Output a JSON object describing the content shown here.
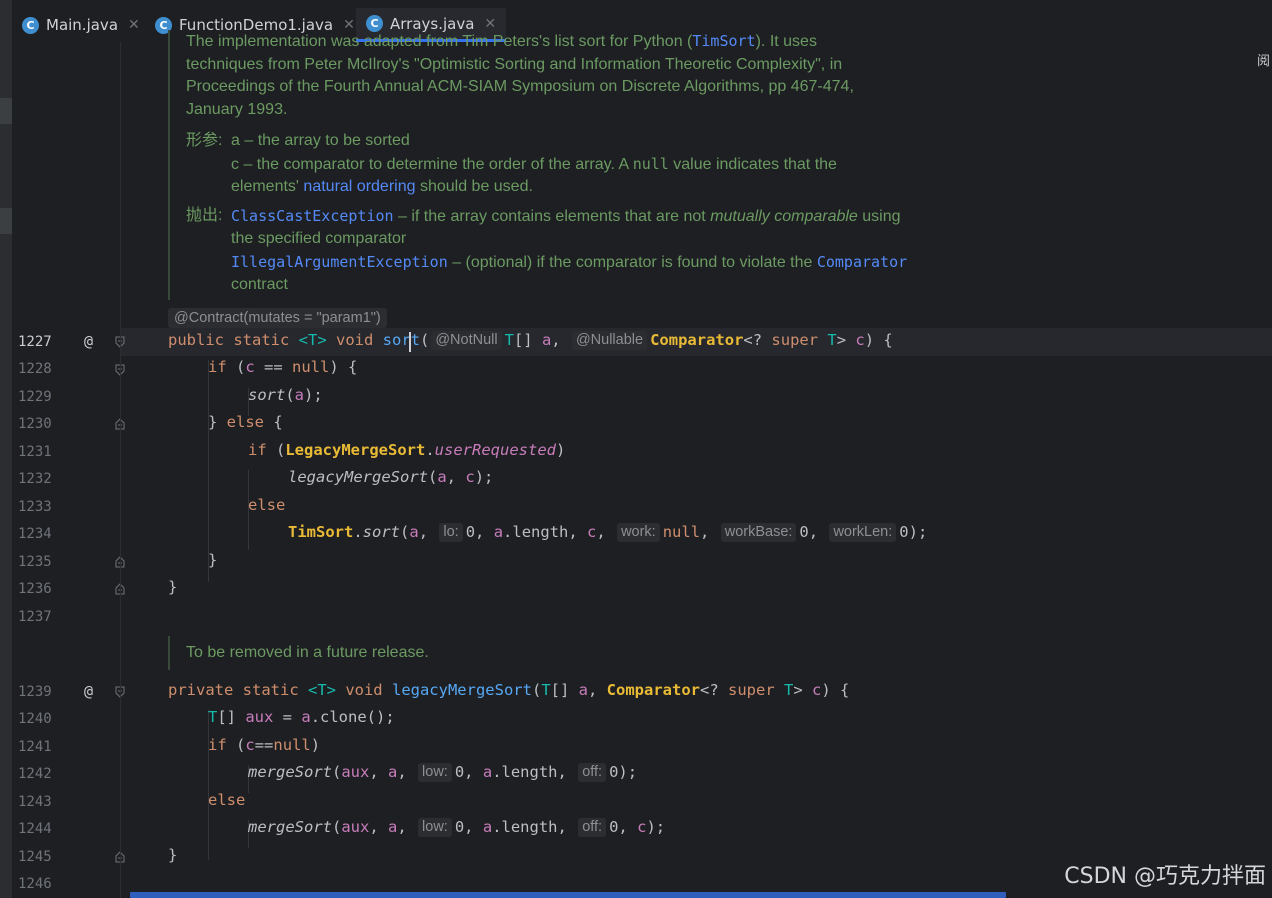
{
  "tabs": [
    {
      "label": "Main.java",
      "icon": "C"
    },
    {
      "label": "FunctionDemo1.java",
      "icon": "C"
    },
    {
      "label": "Arrays.java",
      "icon": "C"
    }
  ],
  "side_label": "阅",
  "doc1": {
    "partial_top": "The implementation was adapted from Tim Peters's list sort for Python (",
    "partial_top_link": "TimSort",
    "partial_top_end": "). It uses",
    "line2": "techniques from Peter McIlroy's \"Optimistic Sorting and Information Theoretic Complexity\", in",
    "line3": "Proceedings of the Fourth Annual ACM-SIAM Symposium on Discrete Algorithms, pp 467-474,",
    "line4": "January 1993.",
    "params_label": "形参:",
    "param_a": "a – the array to be sorted",
    "param_c_1": "c – the comparator to determine the order of the array. A ",
    "param_c_null": "null",
    "param_c_2": " value indicates that the",
    "param_c_3": "elements' ",
    "param_c_link": "natural ordering",
    "param_c_4": " should be used.",
    "throws_label": "抛出:",
    "throws1_cls": "ClassCastException",
    "throws1_text": " – if the array contains elements that are not ",
    "throws1_em": "mutually comparable",
    "throws1_end": " using",
    "throws1_cont": "the specified comparator",
    "throws2_cls": "IllegalArgumentException",
    "throws2_text": " – (optional) if the comparator is found to violate the ",
    "throws2_link": "Comparator",
    "throws2_cont": "contract"
  },
  "contract_hint": "@Contract(mutates = \"param1\")",
  "doc2": "To be removed in a future release.",
  "line_numbers": [
    "1227",
    "1228",
    "1229",
    "1230",
    "1231",
    "1232",
    "1233",
    "1234",
    "1235",
    "1236",
    "1237",
    "1239",
    "1240",
    "1241",
    "1242",
    "1243",
    "1244",
    "1245",
    "1246"
  ],
  "code": {
    "l1227": {
      "kw1": "public static ",
      "tp": "<T> ",
      "kw2": "void ",
      "fn": "sort",
      "p1": "(",
      "h1": "@NotNull",
      "tp2": "T",
      "p2": "[] ",
      "a": "a",
      "p3": ", ",
      "h2": "@Nullable",
      "cls": "Comparator",
      "p4": "<? ",
      "kw3": "super ",
      "tp3": "T",
      "p5": "> ",
      "c": "c",
      "p6": ") {"
    },
    "l1228": {
      "kw": "if ",
      "p1": "(",
      "c": "c",
      "p2": " == ",
      "nl": "null",
      "p3": ") {"
    },
    "l1229": {
      "fn": "sort",
      "p1": "(",
      "a": "a",
      "p2": ");"
    },
    "l1230": {
      "p1": "} ",
      "kw": "else",
      "p2": " {"
    },
    "l1231": {
      "kw": "if ",
      "p1": "(",
      "cls": "LegacyMergeSort",
      "p2": ".",
      "fld": "userRequested",
      "p3": ")"
    },
    "l1232": {
      "fn": "legacyMergeSort",
      "p1": "(",
      "a": "a",
      "p2": ", ",
      "c": "c",
      "p3": ");"
    },
    "l1233": {
      "kw": "else"
    },
    "l1234": {
      "cls": "TimSort",
      "p1": ".",
      "fn": "sort",
      "p2": "(",
      "a": "a",
      "p3": ", ",
      "h1": "lo:",
      "v1": "0",
      "p4": ", ",
      "a2": "a",
      "p5": ".length, ",
      "c": "c",
      "p6": ", ",
      "h2": "work:",
      "v2": "null",
      "p7": ", ",
      "h3": "workBase:",
      "v3": "0",
      "p8": ", ",
      "h4": "workLen:",
      "v4": "0",
      "p9": ");"
    },
    "l1235": {
      "p": "}"
    },
    "l1236": {
      "p": "}"
    },
    "l1239": {
      "kw1": "private static ",
      "tp": "<T> ",
      "kw2": "void ",
      "fn": "legacyMergeSort",
      "p1": "(",
      "tp2": "T",
      "p2": "[] ",
      "a": "a",
      "p3": ", ",
      "cls": "Comparator",
      "p4": "<? ",
      "kw3": "super ",
      "tp3": "T",
      "p5": "> ",
      "c": "c",
      "p6": ") {"
    },
    "l1240": {
      "tp": "T",
      "p1": "[] ",
      "aux": "aux",
      "p2": " = ",
      "a": "a",
      "p3": ".clone();"
    },
    "l1241": {
      "kw": "if ",
      "p1": "(",
      "c": "c",
      "p2": "==",
      "nl": "null",
      "p3": ")"
    },
    "l1242": {
      "fn": "mergeSort",
      "p1": "(",
      "aux": "aux",
      "p2": ", ",
      "a": "a",
      "p3": ", ",
      "h1": "low:",
      "v1": "0",
      "p4": ", ",
      "a2": "a",
      "p5": ".length, ",
      "h2": "off:",
      "v2": "0",
      "p6": ");"
    },
    "l1243": {
      "kw": "else"
    },
    "l1244": {
      "fn": "mergeSort",
      "p1": "(",
      "aux": "aux",
      "p2": ", ",
      "a": "a",
      "p3": ", ",
      "h1": "low:",
      "v1": "0",
      "p4": ", ",
      "a2": "a",
      "p5": ".length, ",
      "h2": "off:",
      "v2": "0",
      "p6": ", ",
      "c": "c",
      "p7": ");"
    },
    "l1245": {
      "p": "}"
    }
  },
  "override_marker": "@",
  "watermark": "CSDN @巧克力拌面",
  "colors": {
    "keyword": "#cf8e6d",
    "function": "#56a8f5",
    "class": "#e8ba36",
    "param": "#c77dbb",
    "doc": "#6b9a62",
    "link": "#548af7",
    "accent": "#3574f0"
  }
}
